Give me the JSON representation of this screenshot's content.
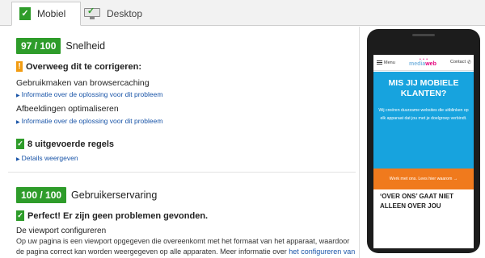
{
  "tabs": [
    {
      "label": "Mobiel",
      "active": true
    },
    {
      "label": "Desktop",
      "active": false
    }
  ],
  "speed": {
    "score": "97 / 100",
    "label": "Snelheid",
    "consider_heading": "Overweeg dit te corrigeren:",
    "items": [
      {
        "title": "Gebruikmaken van browsercaching",
        "link": "Informatie over de oplossing voor dit probleem"
      },
      {
        "title": "Afbeeldingen optimaliseren",
        "link": "Informatie over de oplossing voor dit probleem"
      }
    ],
    "passed_heading": "8 uitgevoerde regels",
    "details_link": "Details weergeven"
  },
  "ux": {
    "score": "100 / 100",
    "label": "Gebruikerservaring",
    "perfect_heading": "Perfect! Er zijn geen problemen gevonden.",
    "viewport_title": "De viewport configureren",
    "body_text": "Op uw pagina is een viewport opgegeven die overeenkomt met het formaat van het apparaat, waardoor de pagina correct kan worden weergegeven op alle apparaten. Meer informatie over",
    "body_link": "het configureren van viewports",
    "body_end": "."
  },
  "phone_site": {
    "nav_menu": "Menu",
    "logo_prefix": "media",
    "logo_suffix": "web",
    "nav_contact": "Contact",
    "hero_title": "Mis jij mobiele klanten?",
    "hero_text": "Wij creëren duurzame websites die uitblinken op elk apparaat dat jou met je doelgroep verbindt.",
    "hero_button": "Werk met ons. Lees hier waarom →",
    "section_title": "‘Over ons’ gaat niet alleen over jou"
  },
  "colors": {
    "pass_green": "#2e9c2a",
    "warn_orange": "#f29c12",
    "link_blue": "#1a55a8",
    "hero_blue": "#17a3de",
    "cta_orange": "#f07a1d",
    "brand_pink": "#e4007c"
  },
  "icons": {
    "mobile_tab": "check-icon",
    "desktop_tab": "monitor-check-icon",
    "warning": "exclamation-icon",
    "passed": "check-icon"
  }
}
